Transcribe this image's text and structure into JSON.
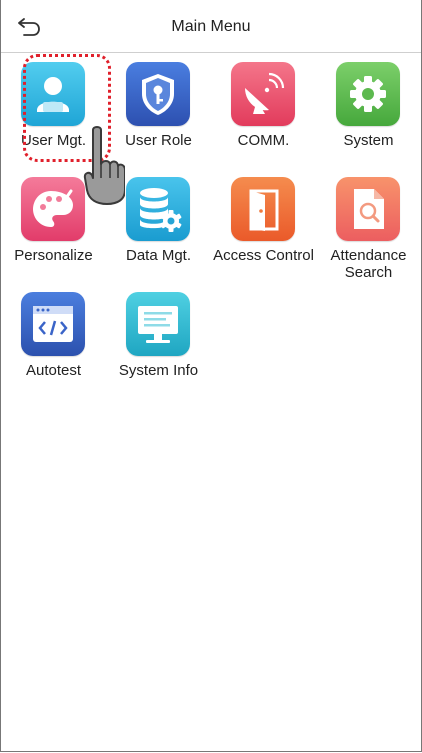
{
  "header": {
    "title": "Main Menu",
    "back_icon": "back-arrow-icon"
  },
  "menu": [
    {
      "id": "user-mgt",
      "label": "User Mgt.",
      "icon": "user-icon",
      "color": "#29b6e0"
    },
    {
      "id": "user-role",
      "label": "User Role",
      "icon": "shield-key-icon",
      "color": "#3a64c8"
    },
    {
      "id": "comm",
      "label": "COMM.",
      "icon": "satellite-dish-icon",
      "color": "#e94e68"
    },
    {
      "id": "system",
      "label": "System",
      "icon": "gear-icon",
      "color": "#5bbd4f"
    },
    {
      "id": "personalize",
      "label": "Personalize",
      "icon": "palette-icon",
      "color": "#e84f7a"
    },
    {
      "id": "data-mgt",
      "label": "Data Mgt.",
      "icon": "database-gear-icon",
      "color": "#20a9d8"
    },
    {
      "id": "access-control",
      "label": "Access Control",
      "icon": "door-icon",
      "color": "#ef6a3a"
    },
    {
      "id": "attendance-search",
      "label": "Attendance\nSearch",
      "icon": "document-search-icon",
      "color": "#ef6a5a"
    },
    {
      "id": "autotest",
      "label": "Autotest",
      "icon": "code-window-icon",
      "color": "#3a64c8"
    },
    {
      "id": "system-info",
      "label": "System Info",
      "icon": "monitor-icon",
      "color": "#2eb9cf"
    }
  ],
  "selected": "user-mgt",
  "focus_color": "#e0202b"
}
